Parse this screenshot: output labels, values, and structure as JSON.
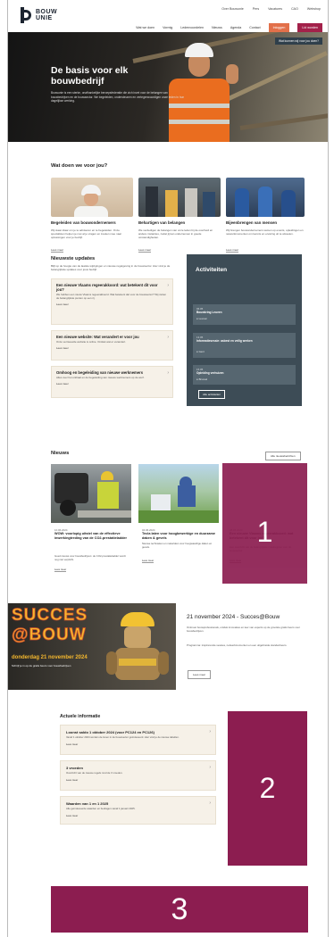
{
  "header": {
    "logo_line1": "BOUW",
    "logo_line2": "UNIE",
    "util_links": [
      "Over Bouwunie",
      "Pers",
      "Vacatures",
      "CAO",
      "Webshop"
    ],
    "nav_links": [
      "Wat we doen",
      "Vormig",
      "Ledenvoordelen",
      "Nieuws",
      "Agenda",
      "Contact"
    ],
    "login_label": "Inloggen",
    "member_label": "Lid worden"
  },
  "hero": {
    "title": "De basis voor elk bouwbedrijf",
    "text": "Bouwunie is een sterke, onafhankelijke beroepsfederatie die zich inzet voor de belangen van bouwbedrijven en de bouwsector. We begeleiden, ondersteunen en vertegenwoordigen onze leden in hun dagelijkse werking.",
    "tag": "Wat kunnen wij voor jou doen?"
  },
  "services": {
    "heading": "Wat doen we voor jou?",
    "cards": [
      {
        "title": "Begeleiden van bouwondernemers",
        "text": "Wij staan klaar om je te adviseren en te begeleiden. Onze specialisten helpen je met al je vragen en zoeken mee naar oplossingen voor je bedrijf.",
        "more": "Lees meer"
      },
      {
        "title": "Behartigen van belangen",
        "text": "We verdedigen de belangen van onze leden bij de overheid en andere instanties, zodat jij kan ondernemen in goede omstandigheden.",
        "more": "Lees meer"
      },
      {
        "title": "Bijeenbrengen van mensen",
        "text": "Wij brengen bouwondernemers samen op events, opleidingen en netwerkmomenten om kennis en ervaring uit te wisselen.",
        "more": "Lees meer"
      }
    ]
  },
  "updates": {
    "heading": "Nieuwste updates",
    "intro": "Blijf op de hoogte van de laatste wijzigingen en nieuwe regelgeving in de bouwsector. Hier vind je de belangrijkste updates voor jouw bedrijf.",
    "items": [
      {
        "title": "Een nieuwe Vlaams regeerakkoord: wat betekent dit voor jou?",
        "text": "We hebben een nieuw Vlaams regeerakkoord. Wat betekent dat voor de bouwsector? Wij zetten de belangrijkste punten op een rij.",
        "more": "Lees meer"
      },
      {
        "title": "Een nieuwe website: Wat verandert er voor jou",
        "text": "Onze vernieuwde website is online. Ontdek wat er verandert.",
        "more": "Lees meer"
      },
      {
        "title": "Omhoog en begeleiding van nieuwe werknemers",
        "text": "Alles over het onthaal en de begeleiding van nieuwe werknemers op de werf.",
        "more": "Lees meer"
      }
    ]
  },
  "activities": {
    "heading": "Activiteiten",
    "items": [
      {
        "date": "06.05",
        "name": "Bouwkring Leuven",
        "loc": "Leuven"
      },
      {
        "date": "13.05",
        "name": "Informatiesessie: asbest en veilig werken",
        "loc": "Gent"
      },
      {
        "date": "15.05",
        "name": "Opleiding verhuizen",
        "loc": "Brussel"
      }
    ],
    "all_label": "Alle activiteiten"
  },
  "news": {
    "heading": "Nieuws",
    "all_label": "Alle nieuwsberichten",
    "cards": [
      {
        "date": "10.06.2024",
        "title": "WOW: voorlopig uitstel van de effectieve inwerkingtreding van de CO2-prestatieladder",
        "text": "Goed nieuws voor bouwbedrijven: de CO2-prestatieladder wordt nog niet verplicht.",
        "more": "Lees meer"
      },
      {
        "date": "04.06.2024",
        "title": "Tecla laten voor hoogbewerkige en duurzame daken & gevels",
        "text": "Nieuwe technieken en materialen voor hoogwaardige daken en gevels.",
        "more": "Lees meer"
      },
      {
        "date": "28.05.2024",
        "title": "Een nieuwe Vlaams regeerakkoord: wat betekent dit voor jou?",
        "text": "Een overzicht van de belangrijkste maatregelen voor de bouwsector.",
        "more": "Lees meer"
      }
    ]
  },
  "event": {
    "promo_word1": "SUCCES",
    "promo_word2": "@BOUW",
    "promo_date": "donderdag 21 november 2024",
    "promo_sub": "Schrijf je in op de gratis beurs voor bouwbedrijven",
    "title": "21 november 2024 - Succes@Bouw",
    "text1": "Ontmoet bouwprofessionals, ontdek innovaties en leer van experts op de grootste gratis beurs voor bouwbedrijven.",
    "text2": "Programma: inspirerende sessies, netwerkmomenten en een uitgebreide standenbeurs.",
    "btn": "Lees meer"
  },
  "info": {
    "heading": "Actuele informatie",
    "items": [
      {
        "title": "Loonst saldo 1 oktober 2024 (voor PC124 en PC126)",
        "text": "Vanaf 1 oktober 2024 worden de lonen in de bouwsector geïndexeerd. Hier vind je de nieuwe tabellen.",
        "more": "Lees meer"
      },
      {
        "title": "3 vroeden",
        "text": "Overzicht van de nieuwe regels rond de 3 vroeden.",
        "more": "Lees meer"
      },
      {
        "title": "Waarden van 1 en 1 2025",
        "text": "Alle geïndexeerde waarden en bedragen vanaf 1 januari 2025.",
        "more": "Lees meer"
      }
    ]
  },
  "markers": {
    "m1": "1",
    "m2": "2",
    "m3": "3"
  },
  "colors": {
    "brand_dark": "#1c2430",
    "accent_orange": "#e2704a",
    "accent_burgundy": "#a3214a",
    "overlay": "#8c1d50",
    "activity_bg": "#3d4c56"
  }
}
